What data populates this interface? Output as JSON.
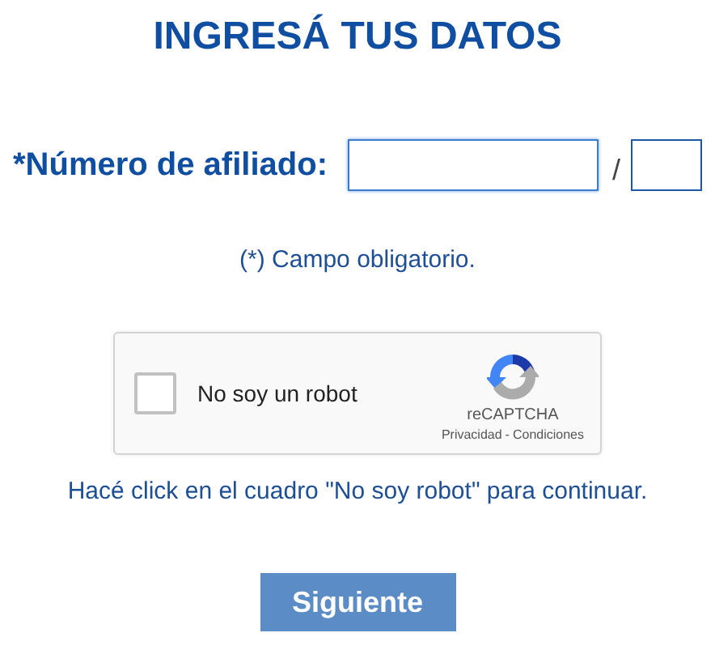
{
  "title": "INGRESÁ TUS DATOS",
  "affiliate": {
    "label": "*Número de afiliado:",
    "separator": "/"
  },
  "required_note": "(*) Campo obligatorio.",
  "captcha": {
    "label": "No soy un robot",
    "checked": false,
    "brand": "reCAPTCHA",
    "privacy": "Privacidad",
    "dash": "-",
    "terms": "Condiciones"
  },
  "hint": "Hacé click en el cuadro \"No soy robot\" para continuar.",
  "buttons": [
    "Siguiente"
  ]
}
